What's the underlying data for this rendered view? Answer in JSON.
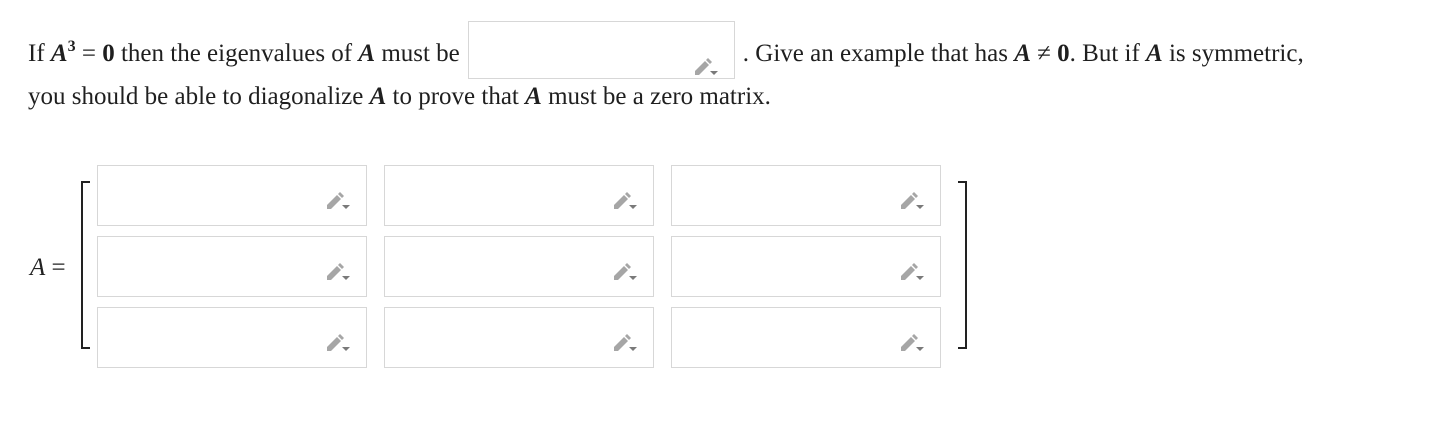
{
  "question": {
    "if": "If",
    "A": "A",
    "exp": "3",
    "eq": " = ",
    "zero": "0",
    "text1": " then the eigenvalues of ",
    "text2": " must be",
    "text3": ". Give an example that has ",
    "neq": " ≠ ",
    "text4": ". But if ",
    "text5": " is symmetric,",
    "line2a": "you should be able to diagonalize ",
    "line2b": " to prove that ",
    "line2c": " must be a zero matrix."
  },
  "answer_box": {
    "value": ""
  },
  "matrix": {
    "label": "A",
    "equals": " =",
    "rows": [
      [
        "",
        "",
        ""
      ],
      [
        "",
        "",
        ""
      ],
      [
        "",
        "",
        ""
      ]
    ]
  },
  "icons": {
    "edit": "pencil-edit-icon"
  },
  "colors": {
    "border": "#d7d7d7",
    "icon": "#9e9e9e",
    "text": "#1f1f1f"
  }
}
